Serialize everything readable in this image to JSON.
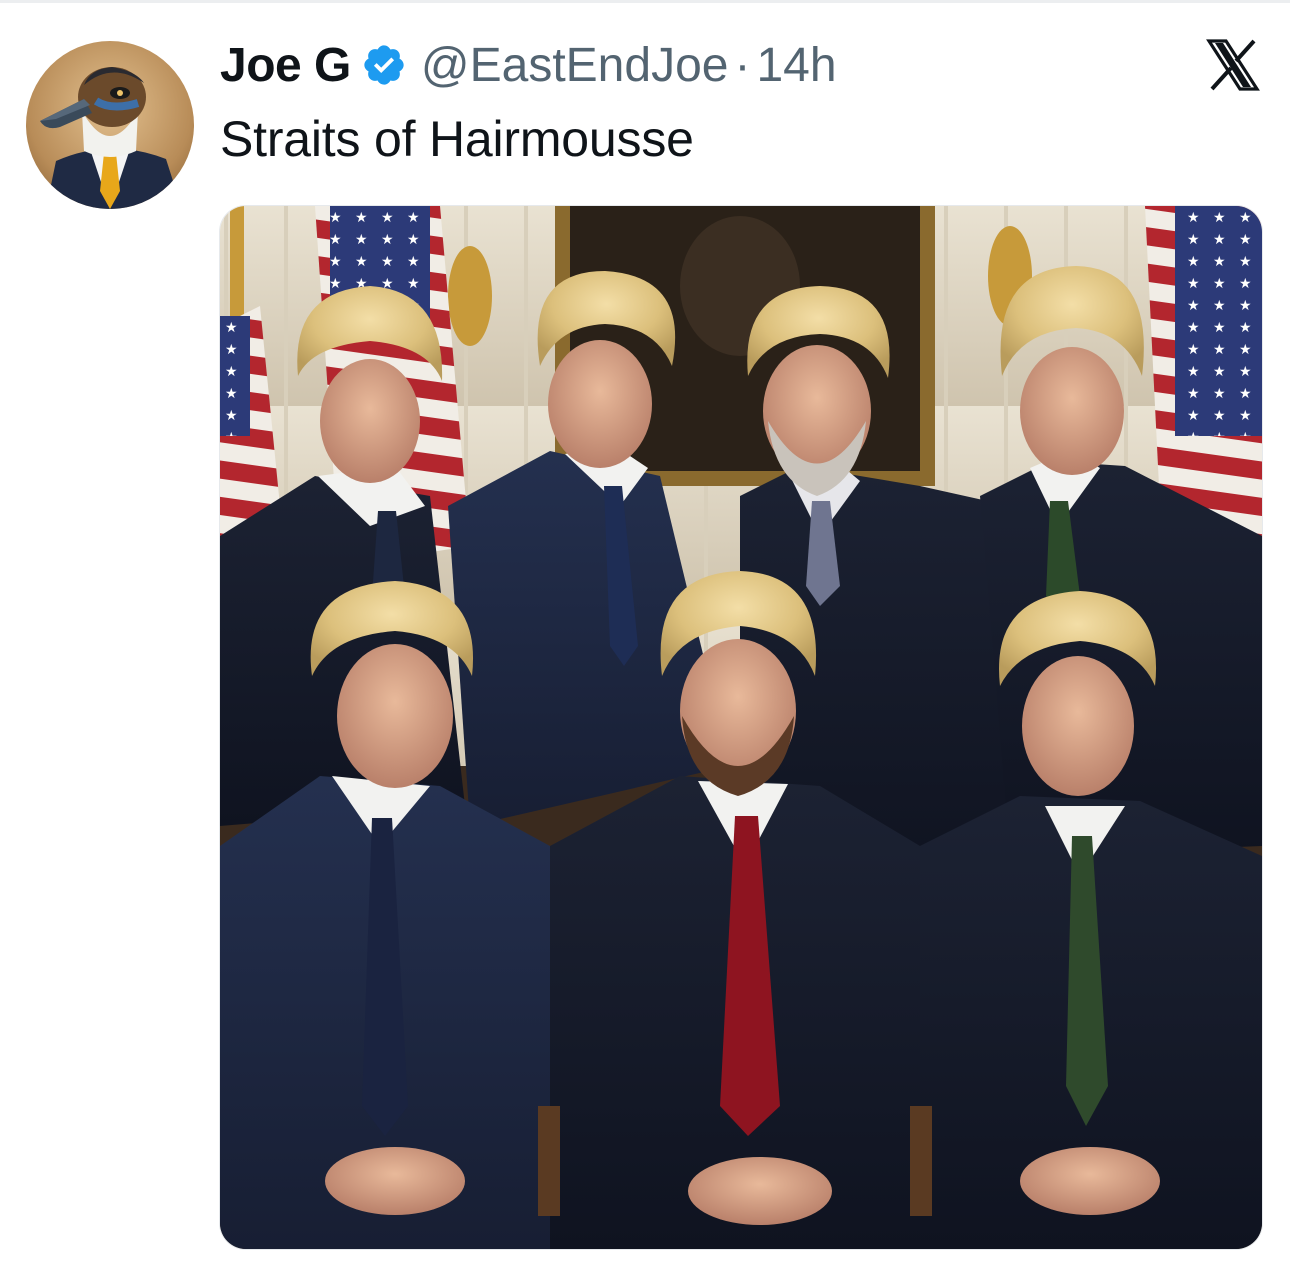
{
  "tweet": {
    "author": {
      "display_name": "Joe G",
      "handle": "@EastEndJoe",
      "verified_icon": "verified-badge-icon",
      "avatar_icon": "duck-in-suit-avatar"
    },
    "separator": "·",
    "timestamp": "14h",
    "text": "Straits of Hairmousse",
    "media_icon": "group-portrait-photo"
  },
  "brand": {
    "logo_icon": "x-logo-icon"
  },
  "colors": {
    "text_primary": "#0f1419",
    "text_secondary": "#536471",
    "verified_blue": "#1d9bf0"
  }
}
